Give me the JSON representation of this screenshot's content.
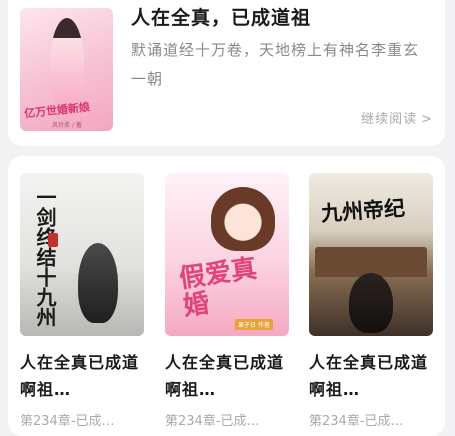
{
  "featured": {
    "cover_title": "亿万世婚新娘",
    "cover_subtitle": "风铃柔 / 著",
    "title": "人在全真，已成道祖",
    "description": "默诵道经十万卷，天地榜上有神名李重玄一朝",
    "continue_label": "继续阅读",
    "continue_icon": "chevron-right-icon"
  },
  "books": [
    {
      "cover_title": "一剑终结十九州",
      "cover_subtitle": "",
      "title": "人在全真已成道啊祖…",
      "meta": "第234章-已成…",
      "colors": {
        "top": "#f0f0ee",
        "bottom": "#c9c9c6"
      }
    },
    {
      "cover_title": "假爱真婚",
      "cover_subtitle": "果子日 作者",
      "title": "人在全真已成道啊祖…",
      "meta": "第234章-已成…",
      "colors": {
        "top": "#fde7ef",
        "bottom": "#f6b7cc"
      }
    },
    {
      "cover_title": "九州帝纪",
      "cover_subtitle": "",
      "title": "人在全真已成道啊祖…",
      "meta": "第234章-已成…",
      "colors": {
        "top": "#e7e2d6",
        "bottom": "#5a4a3a"
      }
    }
  ]
}
